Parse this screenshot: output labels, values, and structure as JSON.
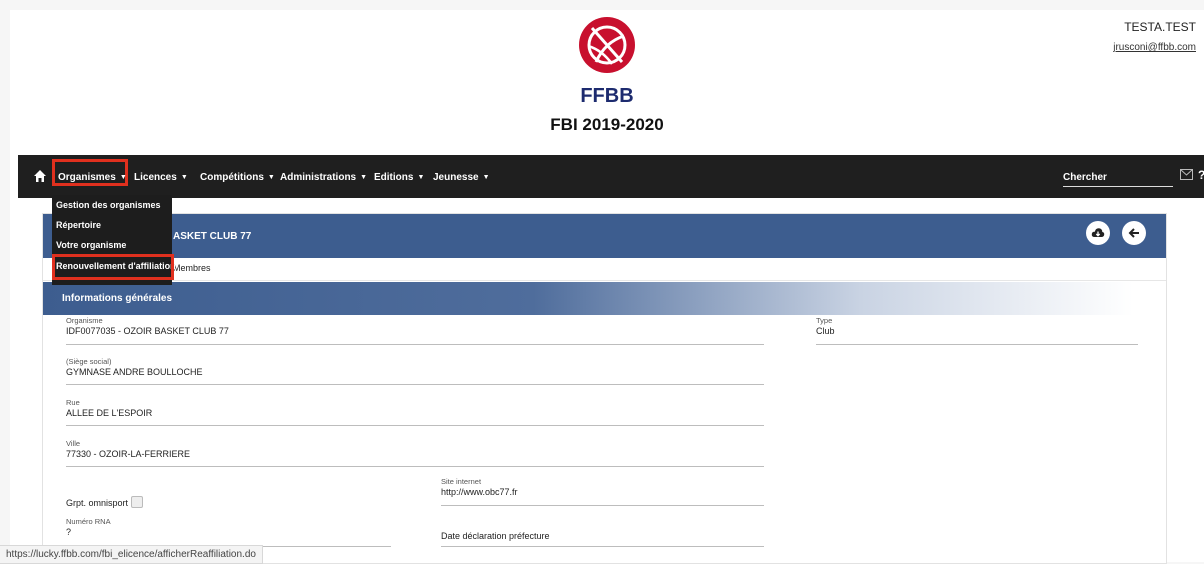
{
  "user": {
    "name": "TESTA.TEST",
    "email": "jrusconi@ffbb.com"
  },
  "logo": {
    "text": "FFBB",
    "color": "#c8102e",
    "accent": "#1d2b6f"
  },
  "app_title": "FBI 2019-2020",
  "navbar": {
    "home_icon": "home-icon",
    "items": [
      {
        "label": "Organismes"
      },
      {
        "label": "Licences"
      },
      {
        "label": "Compétitions"
      },
      {
        "label": "Administrations"
      },
      {
        "label": "Editions"
      },
      {
        "label": "Jeunesse"
      }
    ],
    "search_label": "Chercher",
    "help_label": "?"
  },
  "dropdown": {
    "items": [
      {
        "label": "Gestion des organismes"
      },
      {
        "label": "Répertoire"
      },
      {
        "label": "Votre organisme"
      },
      {
        "label": "Renouvellement d'affiliation"
      }
    ]
  },
  "card": {
    "title": "ASKET CLUB 77",
    "tab_members": "Membres",
    "section_title": "Informations générales"
  },
  "fields": {
    "organisme": {
      "label": "Organisme",
      "value": "IDF0077035 - OZOIR BASKET CLUB 77"
    },
    "type": {
      "label": "Type",
      "value": "Club"
    },
    "siege": {
      "label": "(Siège social)",
      "value": "GYMNASE ANDRE BOULLOCHE"
    },
    "rue": {
      "label": "Rue",
      "value": "ALLEE DE L'ESPOIR"
    },
    "ville": {
      "label": "Ville",
      "value": "77330 - OZOIR-LA-FERRIERE"
    },
    "site": {
      "label": "Site internet",
      "value": "http://www.obc77.fr"
    },
    "omnisport": {
      "label": "Grpt. omnisport"
    },
    "rna": {
      "label": "Numéro RNA",
      "value": "?"
    },
    "prefecture": {
      "label": "Date déclaration préfecture"
    }
  },
  "status_url": "https://lucky.ffbb.com/fbi_elicence/afficherReaffiliation.do",
  "colors": {
    "navbar": "#1f1f1f",
    "header": "#3d5d8f",
    "highlight": "#e0301e"
  }
}
